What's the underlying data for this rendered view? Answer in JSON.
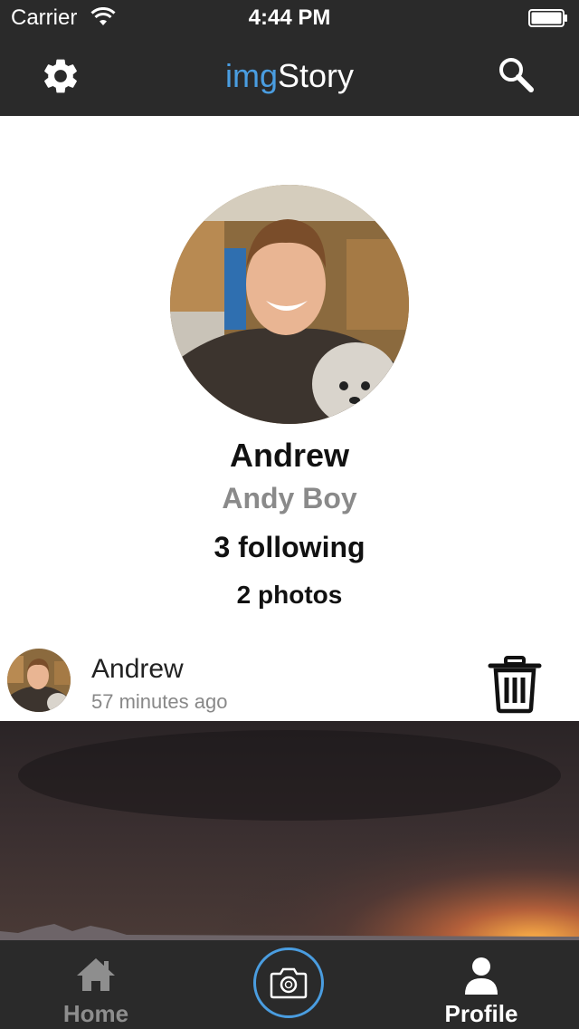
{
  "status_bar": {
    "carrier": "Carrier",
    "time": "4:44 PM"
  },
  "nav": {
    "title_part1": "img",
    "title_part2": "Story",
    "left_icon": "gear-icon",
    "right_icon": "search-icon"
  },
  "profile": {
    "name": "Andrew",
    "username": "Andy Boy",
    "following": "3 following",
    "photos": "2 photos"
  },
  "post": {
    "author": "Andrew",
    "time_ago": "57 minutes ago",
    "action_icon": "trash-icon"
  },
  "tabs": [
    {
      "label": "Home",
      "icon": "home-icon",
      "active": false
    },
    {
      "label": "",
      "icon": "camera-icon",
      "active": false
    },
    {
      "label": "Profile",
      "icon": "person-icon",
      "active": true
    }
  ],
  "colors": {
    "accent": "#4a9de0",
    "bar_bg": "#2a2a2a",
    "tab_inactive": "#8e8e8e",
    "tab_active": "#ffffff"
  }
}
